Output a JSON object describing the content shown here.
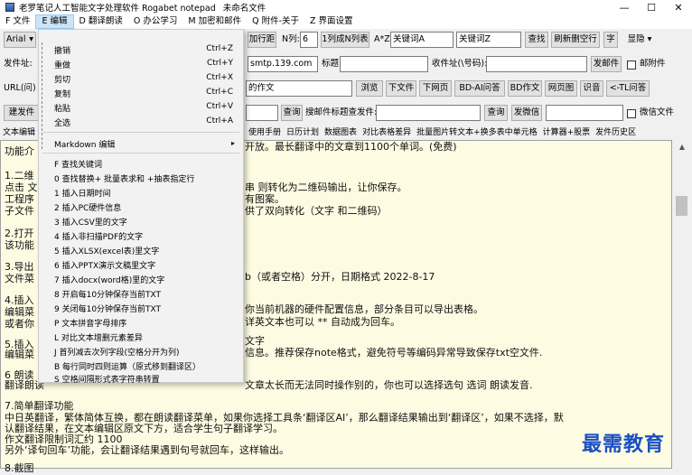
{
  "window": {
    "title_main": "老罗笔记人工智能文字处理软件 Rogabet notepad",
    "title_file": "未命名文件",
    "min": "—",
    "max": "☐",
    "close": "✕"
  },
  "menu": [
    "F 文件",
    "E 编辑",
    "D 翻译朗读",
    "O 办公学习",
    "M 加密和邮件",
    "Q 附件-关于",
    "Z 界面设置"
  ],
  "toolbar1": {
    "font": "Arial",
    "font_arrow": "▾",
    "btn_line_spacing": "加行距",
    "n_label": "N列:",
    "n_value": "6",
    "btn_ncol": "1列成N列表",
    "az_label": "A*Z:",
    "key_a": "关键词A",
    "key_z": "关键词Z",
    "btn_find": "查找",
    "btn_refresh": "刷新删空行",
    "btn_char": "字",
    "btn_display": "显隐",
    "display_arrow": "▾"
  },
  "toolbar2": {
    "sender_label": "发件址:",
    "smtp": "smtp.139.com",
    "subject_label": "标题:",
    "recipient_label": "收件址(\\号码):",
    "btn_send": "发邮件",
    "attach_label": "邮附件"
  },
  "toolbar3": {
    "url_label": "URL(问)",
    "url_value": "的作文",
    "btn_browse": "浏览",
    "btn_next_file": "下文件",
    "btn_next_page": "下网页",
    "btn_bd_ai": "BD-AI问答",
    "btn_bd_article": "BD作文",
    "btn_page_img": "网页图",
    "btn_recognize": "识音",
    "btn_tl": "<-TL问答"
  },
  "toolbar4": {
    "btn_build": "建发件",
    "btn_query": "查询",
    "search_label": "搜邮件标题查发件:",
    "btn_query2": "查询",
    "btn_wechat": "发微信",
    "wechat_file_label": "微信文件"
  },
  "tabs": [
    "文本编辑",
    "使用手册",
    "日历计划",
    "数据图表",
    "对比表格差异",
    "批量图片转文本+换多表中单元格",
    "计算器+股票",
    "发件历史区"
  ],
  "editor_lines": [
    "功能介",
    "开放。最长翻译中的文章到1100个单词。(免费)",
    "1.二维",
    "点击 文",
    "串 则转化为二维码输出，让你保存。",
    "工程序",
    "有图案。",
    "子文件",
    "供了双向转化（文字 和二维码）",
    "2.打开",
    "该功能",
    "3.导出",
    "文件菜",
    "b（或者空格）分开，日期格式 2022-8-17",
    "4.插入",
    "编辑菜",
    "你当前机器的硬件配置信息，部分条目可以导出表格。",
    "或者你",
    "详英文本也可以 ** 自动成为回车。",
    "5.插入",
    "文字",
    "编辑菜",
    "信息。推荐保存note格式，避免符号等编码异常导致保存txt空文件.",
    "6 朗读",
    "翻译朗读",
    "文章太长而无法同时操作别的，你也可以选择选句 选词 朗读发音.",
    "7.简单翻译功能",
    "中日英翻译，繁体简体互换，都在朗读翻译菜单，如果你选择工具条‘翻译区AI’，那么翻译结果输出到‘翻译区’，如果不选择，默",
    "认翻译结果，在文本编辑区原文下方，适合学生句子翻译学习。",
    "作文翻译限制词汇约 1100",
    "另外‘译句回车’功能，会让翻译结果遇到句号就回车，这样输出。",
    "8.截图"
  ],
  "dropdown": {
    "items_a": [
      {
        "t": "撤销",
        "k": "Ctrl+Z"
      },
      {
        "t": "重做",
        "k": "Ctrl+Y"
      },
      {
        "t": "剪切",
        "k": "Ctrl+X"
      },
      {
        "t": "复制",
        "k": "Ctrl+C"
      },
      {
        "t": "粘贴",
        "k": "Ctrl+V"
      },
      {
        "t": "全选",
        "k": "Ctrl+A"
      }
    ],
    "markdown": "Markdown 编辑",
    "markdown_arrow": "▸",
    "items_b": [
      "F 查找关键词",
      "0 查找替换+ 批量表求和 +抽表指定行",
      "1 插入日期时间",
      "2 插入PC硬件信息",
      "3 插入CSV里的文字",
      "4 插入非扫描PDF的文字",
      "5 插入XLSX(excel表)里文字",
      "6 插入PPTX演示文稿里文字",
      "7 插入docx(word格)里的文字",
      "8 开启每10分钟保存当前TXT",
      "9 关闭每10分钟保存当前TXT",
      "P 文本拼音字母排序",
      "L 对比文本增删元素差异",
      "J 首列减去次列字段(空格分开为列)",
      "B 每行同时四则运算（原式移到翻译区）",
      "S 空格间隔形式表字符串转置"
    ]
  },
  "watermark": "最需教育",
  "scroll_up": "▲",
  "colors": {
    "editor_bg": "#fdfbe2",
    "menu_active": "#cce4f7",
    "watermark": "#1a4fc4"
  }
}
